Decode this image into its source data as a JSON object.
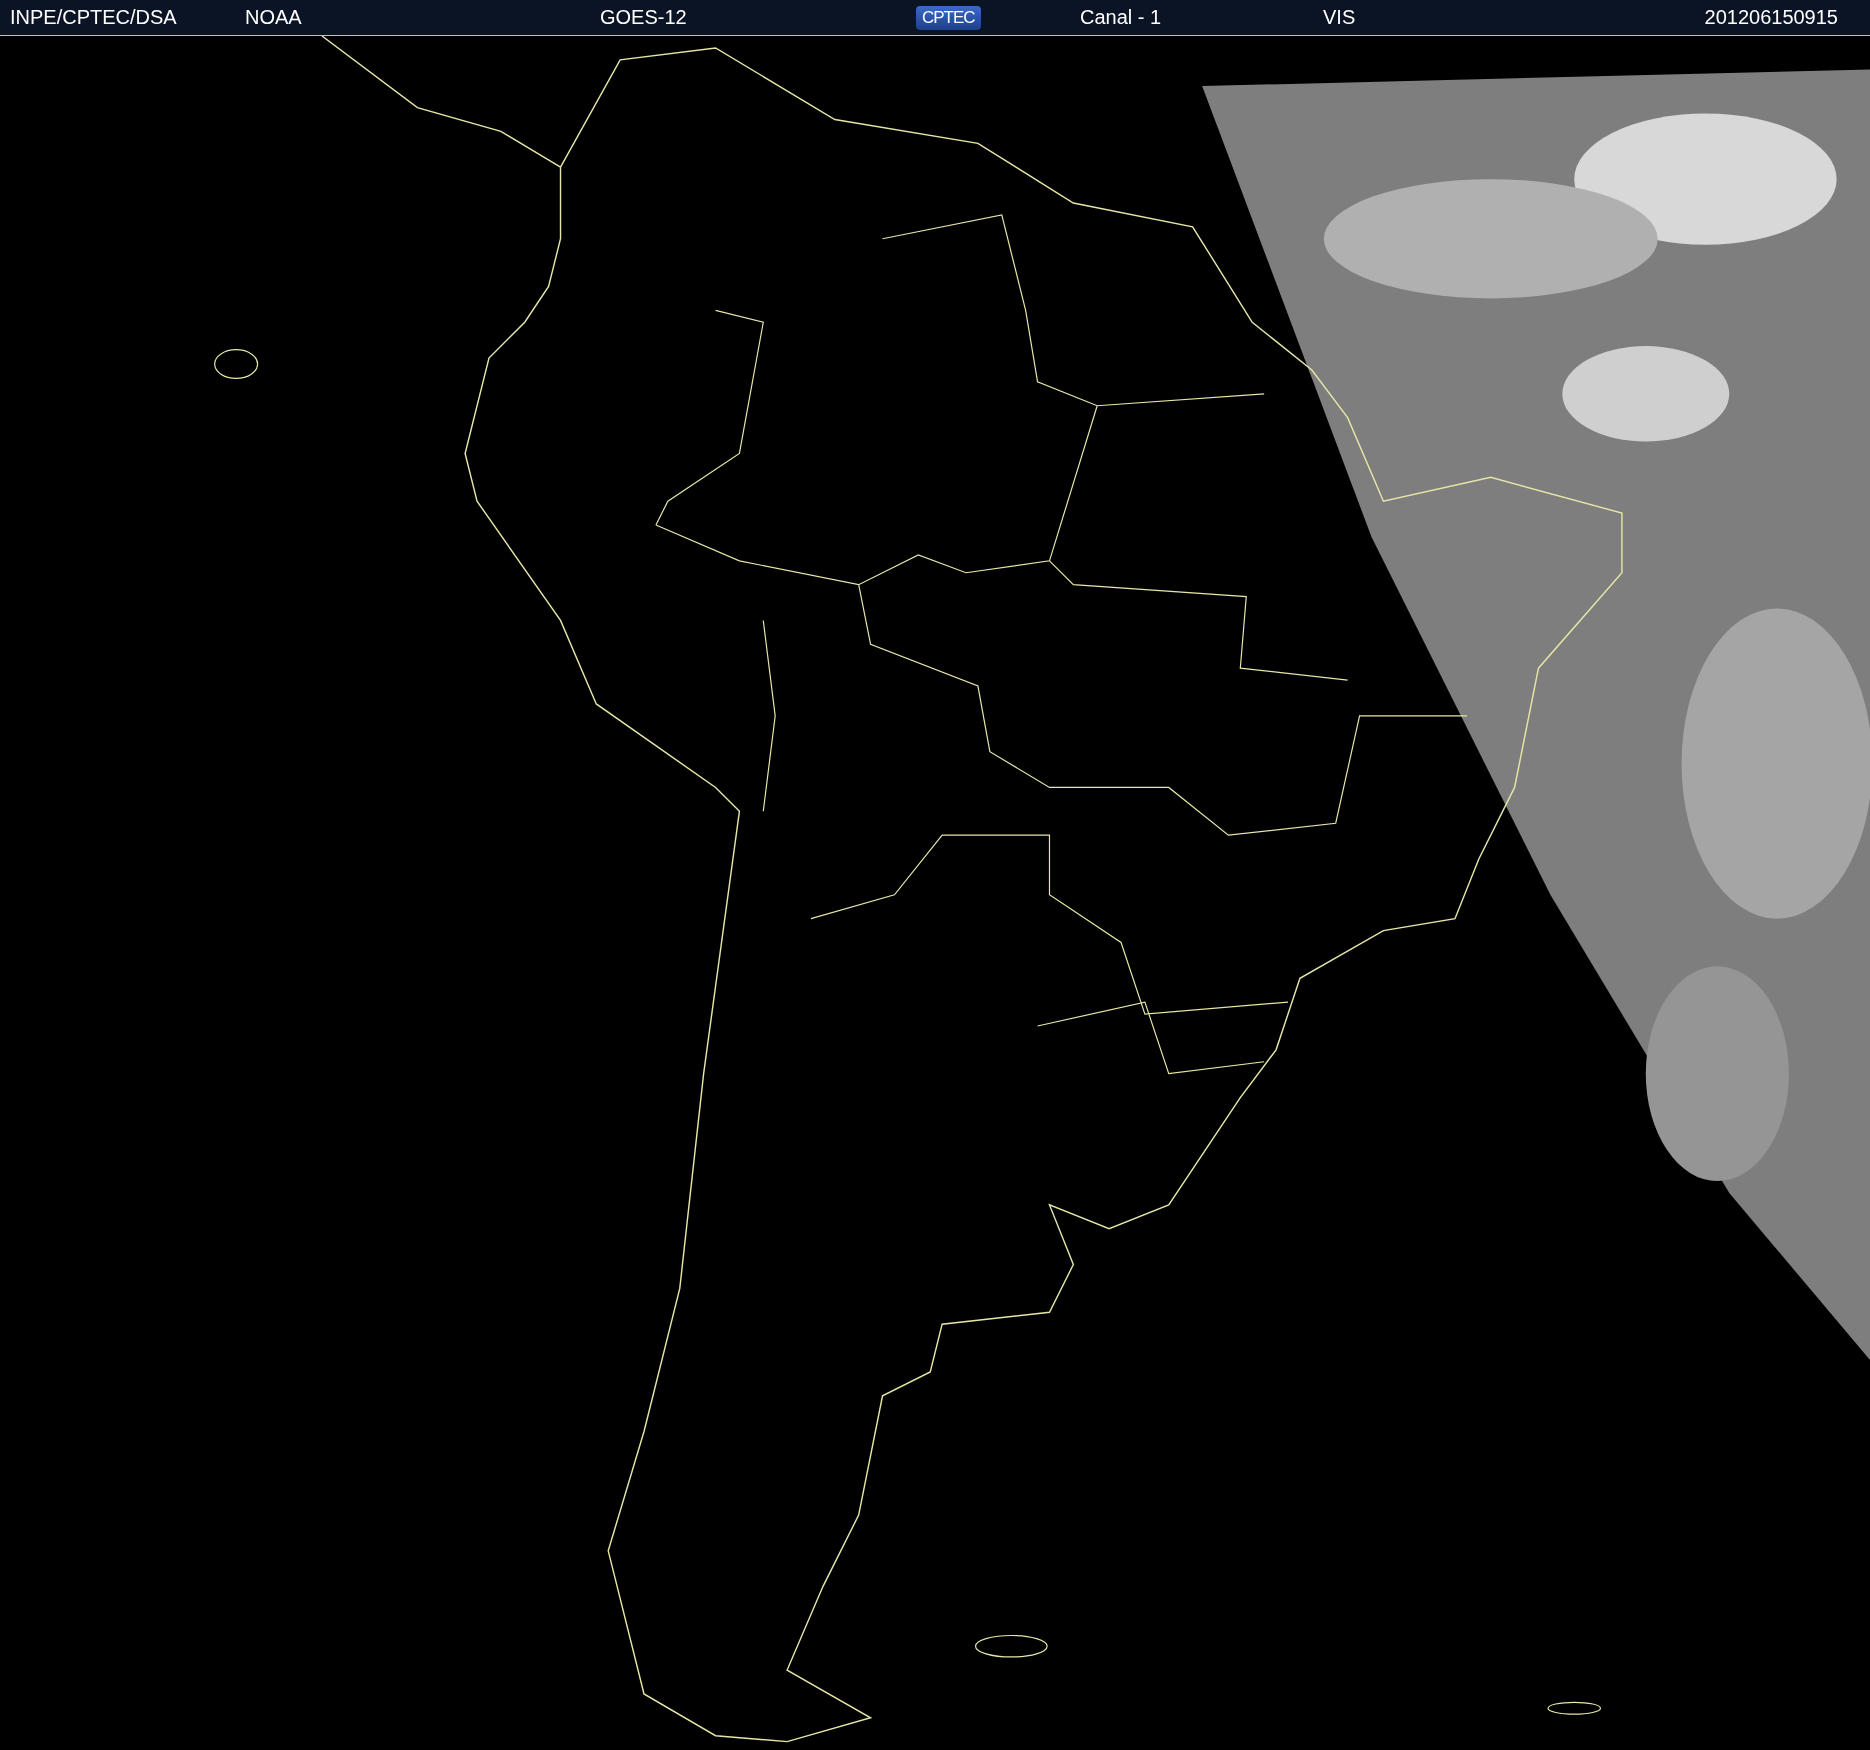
{
  "header": {
    "source": "INPE/CPTEC/DSA",
    "agency": "NOAA",
    "satellite": "GOES-12",
    "logo": "CPTEC",
    "channel": "Canal - 1",
    "band": "VIS",
    "timestamp": "201206150915"
  }
}
